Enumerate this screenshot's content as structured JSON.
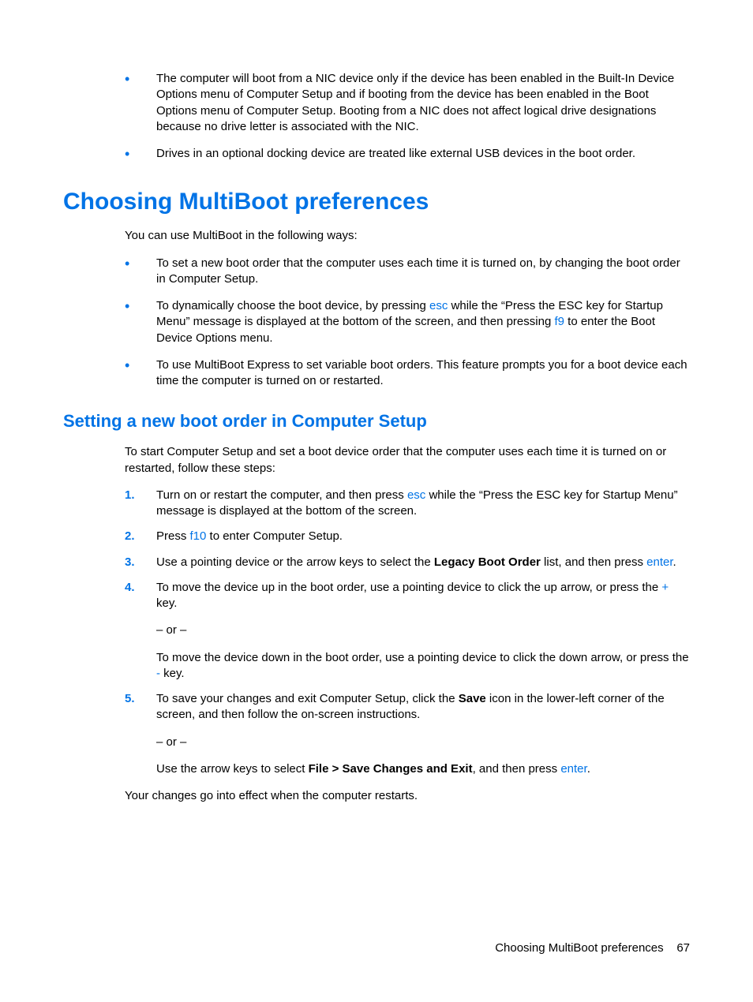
{
  "topBullets": [
    "The computer will boot from a NIC device only if the device has been enabled in the Built-In Device Options menu of Computer Setup and if booting from the device has been enabled in the Boot Options menu of Computer Setup. Booting from a NIC does not affect logical drive designations because no drive letter is associated with the NIC.",
    "Drives in an optional docking device are treated like external USB devices in the boot order."
  ],
  "h1": "Choosing MultiBoot preferences",
  "intro1": "You can use MultiBoot in the following ways:",
  "bullets2": {
    "b1": "To set a new boot order that the computer uses each time it is turned on, by changing the boot order in Computer Setup.",
    "b2a": "To dynamically choose the boot device, by pressing ",
    "b2_esc": "esc",
    "b2b": " while the “Press the ESC key for Startup Menu” message is displayed at the bottom of the screen, and then pressing ",
    "b2_f9": "f9",
    "b2c": " to enter the Boot Device Options menu.",
    "b3": "To use MultiBoot Express to set variable boot orders. This feature prompts you for a boot device each time the computer is turned on or restarted."
  },
  "h2": "Setting a new boot order in Computer Setup",
  "intro2": "To start Computer Setup and set a boot device order that the computer uses each time it is turned on or restarted, follow these steps:",
  "steps": {
    "s1a": "Turn on or restart the computer, and then press ",
    "s1_esc": "esc",
    "s1b": " while the “Press the ESC key for Startup Menu” message is displayed at the bottom of the screen.",
    "s2a": "Press ",
    "s2_f10": "f10",
    "s2b": " to enter Computer Setup.",
    "s3a": "Use a pointing device or the arrow keys to select the ",
    "s3_bold": "Legacy Boot Order",
    "s3b": " list, and then press ",
    "s3_enter": "enter",
    "s3c": ".",
    "s4a": "To move the device up in the boot order, use a pointing device to click the up arrow, or press the ",
    "s4_plus": "+",
    "s4b": " key.",
    "s4_or": "– or –",
    "s4c": "To move the device down in the boot order, use a pointing device to click the down arrow, or press the ",
    "s4_minus": "-",
    "s4d": " key.",
    "s5a": "To save your changes and exit Computer Setup, click the ",
    "s5_save": "Save",
    "s5b": " icon in the lower-left corner of the screen, and then follow the on-screen instructions.",
    "s5_or": "– or –",
    "s5c": "Use the arrow keys to select ",
    "s5_path": "File > Save Changes and Exit",
    "s5d": ", and then press ",
    "s5_enter": "enter",
    "s5e": "."
  },
  "closing": "Your changes go into effect when the computer restarts.",
  "footer_title": "Choosing MultiBoot preferences",
  "footer_page": "67"
}
